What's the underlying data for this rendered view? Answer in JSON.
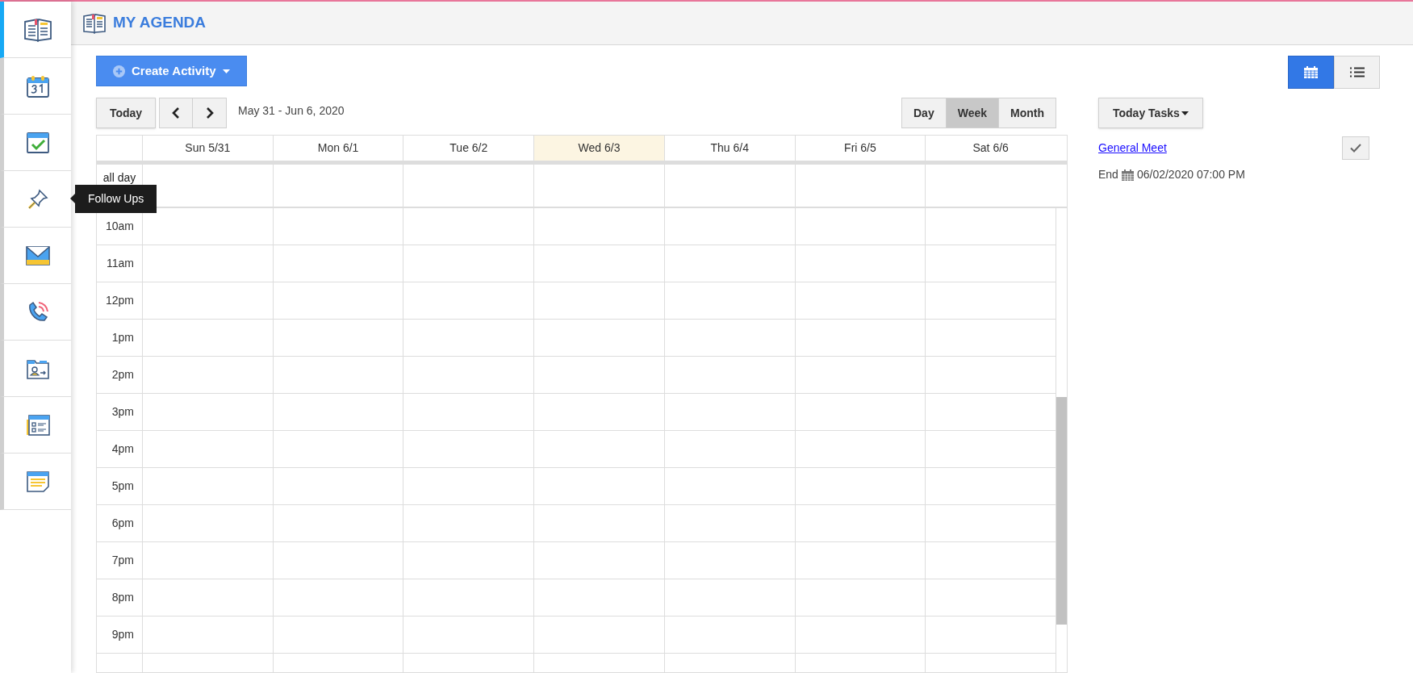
{
  "sidebar": {
    "items": [
      {
        "selected": true
      },
      {
        "selected": false
      },
      {
        "selected": false
      },
      {
        "selected": false,
        "tooltip": "Follow Ups"
      },
      {
        "selected": false
      },
      {
        "selected": false
      },
      {
        "selected": false
      },
      {
        "selected": false
      },
      {
        "selected": false
      }
    ]
  },
  "header": {
    "title": "MY AGENDA"
  },
  "toolbar": {
    "create_button": "Create Activity",
    "layout_toggle": [
      {
        "selected": true
      },
      {
        "selected": false
      }
    ]
  },
  "nav": {
    "today_button": "Today",
    "range": "May 31 - Jun 6, 2020",
    "view_modes": [
      {
        "label": "Day",
        "selected": false
      },
      {
        "label": "Week",
        "selected": true
      },
      {
        "label": "Month",
        "selected": false
      }
    ]
  },
  "calendar": {
    "days": [
      {
        "label": "Sun 5/31",
        "today": false
      },
      {
        "label": "Mon 6/1",
        "today": false
      },
      {
        "label": "Tue 6/2",
        "today": false
      },
      {
        "label": "Wed 6/3",
        "today": true
      },
      {
        "label": "Thu 6/4",
        "today": false
      },
      {
        "label": "Fri 6/5",
        "today": false
      },
      {
        "label": "Sat 6/6",
        "today": false
      }
    ],
    "all_day_label": "all day",
    "hours": [
      "10am",
      "11am",
      "12pm",
      "1pm",
      "2pm",
      "3pm",
      "4pm",
      "5pm",
      "6pm",
      "7pm",
      "8pm",
      "9pm"
    ]
  },
  "tasks": {
    "dropdown": "Today Tasks",
    "items": [
      {
        "title": "General Meet",
        "end_label": "End",
        "end": "06/02/2020 07:00 PM"
      }
    ]
  }
}
